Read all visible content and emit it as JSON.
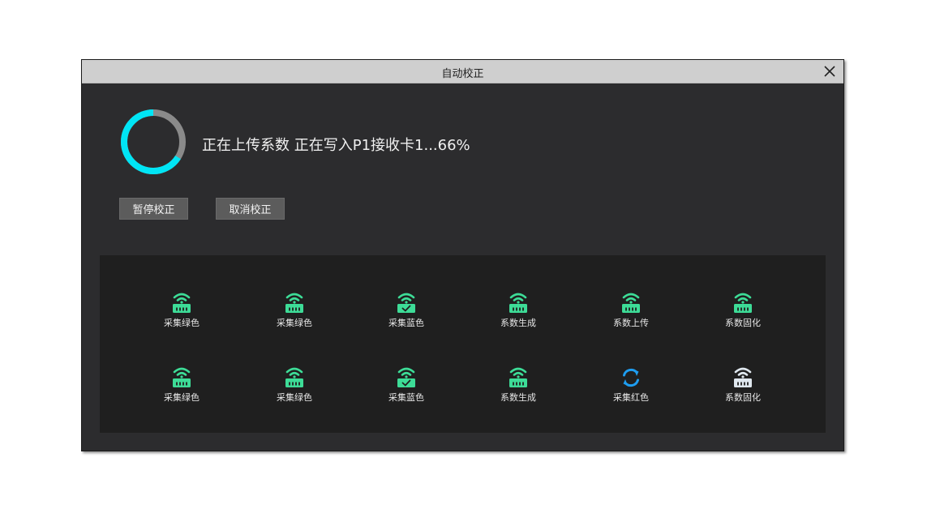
{
  "dialog": {
    "title": "自动校正",
    "status_text": "正在上传系数 正在写入P1接收卡1...66%",
    "progress": 0.66,
    "pause_label": "暂停校正",
    "cancel_label": "取消校正"
  },
  "colors": {
    "accent_green": "#3ddc97",
    "progress_cyan": "#00e5f5",
    "progress_track": "#8a8a8a",
    "refresh_blue": "#1e9df0",
    "pending_white": "#dfe7ee"
  },
  "steps": [
    {
      "label": "采集绿色",
      "icon": "router-wifi-icon",
      "state": "done"
    },
    {
      "label": "采集绿色",
      "icon": "router-wifi-icon",
      "state": "done"
    },
    {
      "label": "采集蓝色",
      "icon": "router-wifi-check-icon",
      "state": "done"
    },
    {
      "label": "系数生成",
      "icon": "router-wifi-icon",
      "state": "done"
    },
    {
      "label": "系数上传",
      "icon": "router-wifi-icon",
      "state": "done"
    },
    {
      "label": "系数固化",
      "icon": "router-wifi-icon",
      "state": "done"
    },
    {
      "label": "采集绿色",
      "icon": "router-wifi-icon",
      "state": "done"
    },
    {
      "label": "采集绿色",
      "icon": "router-wifi-icon",
      "state": "done"
    },
    {
      "label": "采集蓝色",
      "icon": "router-wifi-check-icon",
      "state": "done"
    },
    {
      "label": "系数生成",
      "icon": "router-wifi-icon",
      "state": "done"
    },
    {
      "label": "采集红色",
      "icon": "refresh-icon",
      "state": "active"
    },
    {
      "label": "系数固化",
      "icon": "router-wifi-icon",
      "state": "pending"
    }
  ]
}
